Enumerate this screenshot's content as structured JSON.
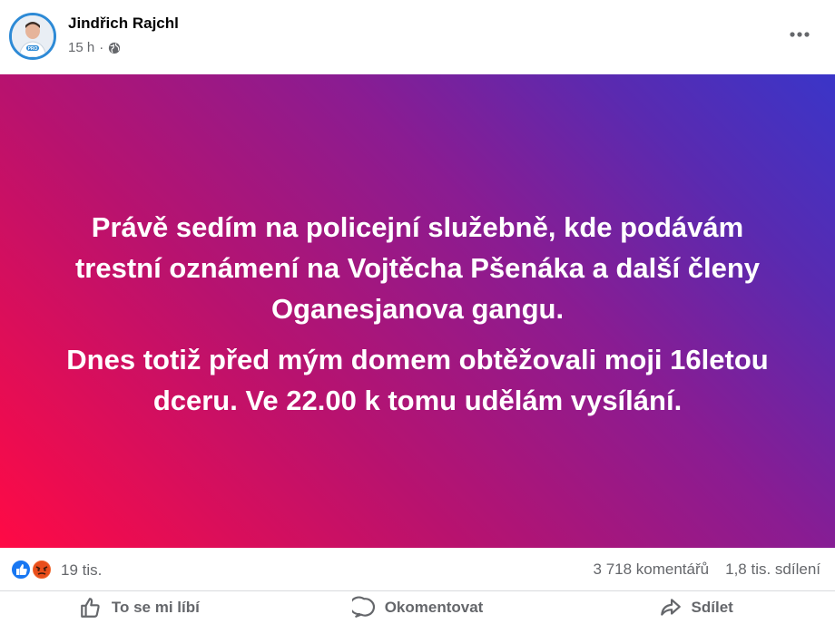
{
  "post": {
    "author": "Jindřich Rajchl",
    "time": "15 h",
    "separator": "·",
    "audience_icon": "globe-icon",
    "more_icon": "more-options-icon",
    "paragraph_1": "Právě sedím na policejní služebně, kde podávám trestní oznámení na Vojtěcha Pšenáka a další členy Oganesjanova gangu.",
    "paragraph_2": "Dnes totiž před mým domem obtěžovali moji 16letou dceru. Ve 22.00 k tomu udělám vysílání.",
    "avatar_badge": "PRO",
    "colors": {
      "gradient_start": "#ff0a45",
      "gradient_mid": "#8a1c92",
      "gradient_end": "#3a35c8",
      "avatar_ring": "#2d8ad6"
    }
  },
  "stats": {
    "reactions": [
      "like-icon",
      "angry-icon"
    ],
    "reaction_count": "19 tis.",
    "comments": "3 718 komentářů",
    "shares": "1,8 tis. sdílení"
  },
  "actions": {
    "like": "To se mi líbí",
    "comment": "Okomentovat",
    "share": "Sdílet"
  }
}
